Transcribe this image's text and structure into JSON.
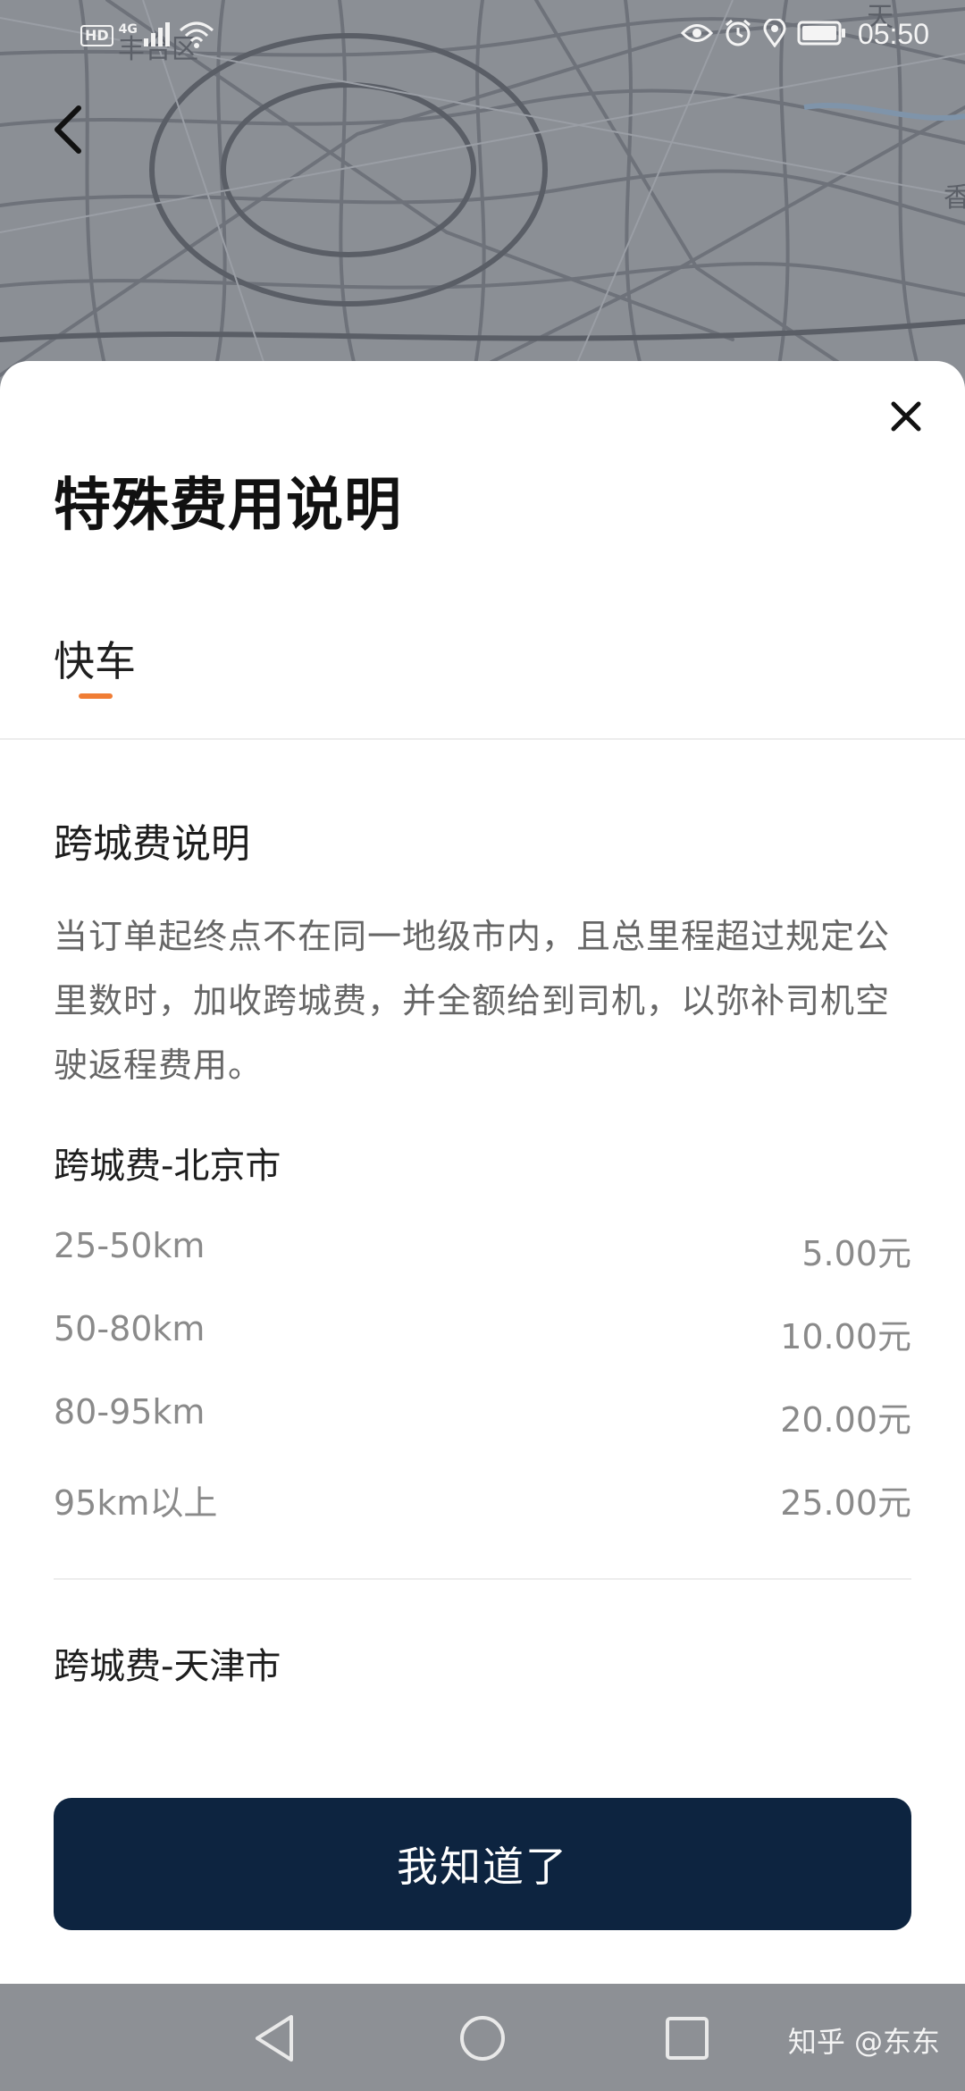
{
  "status_bar": {
    "hd_badge": "HD",
    "network_type": "4G",
    "time": "05:50"
  },
  "map": {
    "label_district": "丰台区",
    "label_right_top": "天",
    "label_right_mid": "香"
  },
  "sheet": {
    "title": "特殊费用说明",
    "tabs": [
      {
        "label": "快车",
        "active": true
      }
    ],
    "section": {
      "title": "跨城费说明",
      "description": "当订单起终点不在同一地级市内，且总里程超过规定公里数时，加收跨城费，并全额给到司机，以弥补司机空驶返程费用。"
    },
    "beijing": {
      "title": "跨城费-北京市",
      "rows": [
        {
          "range": "25-50km",
          "fee": "5.00元"
        },
        {
          "range": "50-80km",
          "fee": "10.00元"
        },
        {
          "range": "80-95km",
          "fee": "20.00元"
        },
        {
          "range": "95km以上",
          "fee": "25.00元"
        }
      ]
    },
    "tianjin": {
      "title": "跨城费-天津市"
    },
    "confirm_label": "我知道了"
  },
  "watermark": "知乎 @东东",
  "colors": {
    "accent_tab": "#f07d35",
    "button_bg": "#0d2440",
    "map_bg": "#8b8f95"
  }
}
